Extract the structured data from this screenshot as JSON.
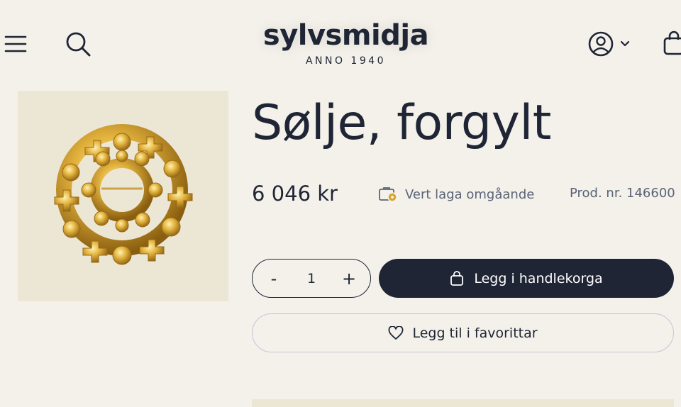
{
  "header": {
    "logo_text": "sylvsmidja",
    "logo_tagline": "ANNO 1940",
    "icons": {
      "menu": "hamburger-menu-icon",
      "search": "search-icon",
      "account": "user-circle-icon",
      "chevron": "chevron-down-icon",
      "cart": "shopping-bag-icon"
    }
  },
  "product": {
    "title": "Sølje, forgylt",
    "price": "6 046 kr",
    "availability": "Vert laga omgåande",
    "product_number": "Prod. nr. 146600",
    "image_alt": "sølje-image"
  },
  "purchase": {
    "qty_minus": "-",
    "qty_value": "1",
    "qty_plus": "+",
    "add_to_cart": "Legg i handlekorga",
    "add_to_favorites": "Legg til i favorittar"
  },
  "colors": {
    "background": "#f3f1ea",
    "primary": "#1f2535",
    "image_bg": "#ece6d4",
    "muted_text": "#5a6478",
    "gold": "#d9a42c"
  }
}
